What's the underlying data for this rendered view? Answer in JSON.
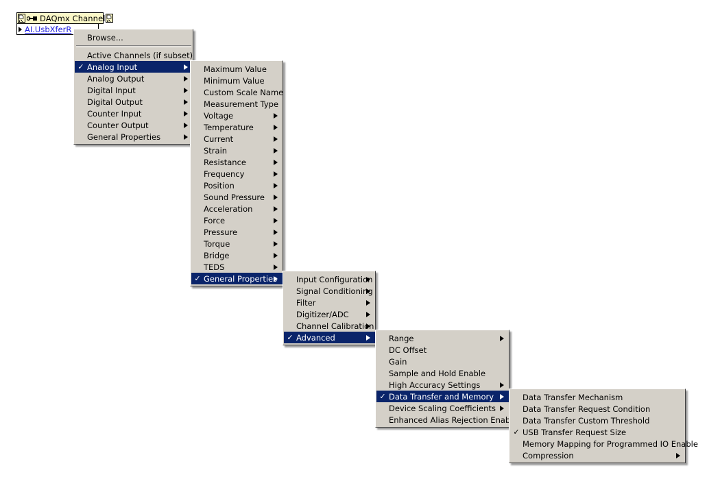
{
  "control": {
    "title": "DAQmx Channel",
    "value": "AI.UsbXferR",
    "icon_left": "document-glyph-icon",
    "icon_connector": "wire-connector-icon",
    "icon_right": "document-glyph-icon",
    "dropdown_arrow": "triangle-right-icon"
  },
  "colors": {
    "menu_background": "#d4d0c8",
    "menu_highlight": "#0a246a",
    "highlight_text": "#ffffff",
    "control_header": "#fbf8c8",
    "link_text": "#2222dd",
    "page_background": "#ffffff"
  },
  "menus": [
    {
      "name": "daqmx-channel-root-menu",
      "items": [
        {
          "label": "Browse...",
          "checked": false,
          "submenu": false
        },
        {
          "separator": true
        },
        {
          "label": "Active Channels (if subset)",
          "checked": false,
          "submenu": false
        },
        {
          "label": "Analog Input",
          "checked": true,
          "submenu": true,
          "selected": true
        },
        {
          "label": "Analog Output",
          "checked": false,
          "submenu": true
        },
        {
          "label": "Digital Input",
          "checked": false,
          "submenu": true
        },
        {
          "label": "Digital Output",
          "checked": false,
          "submenu": true
        },
        {
          "label": "Counter Input",
          "checked": false,
          "submenu": true
        },
        {
          "label": "Counter Output",
          "checked": false,
          "submenu": true
        },
        {
          "label": "General Properties",
          "checked": false,
          "submenu": true
        }
      ]
    },
    {
      "name": "analog-input-submenu",
      "items": [
        {
          "label": "Maximum Value",
          "checked": false,
          "submenu": false
        },
        {
          "label": "Minimum Value",
          "checked": false,
          "submenu": false
        },
        {
          "label": "Custom Scale Name",
          "checked": false,
          "submenu": false
        },
        {
          "label": "Measurement Type",
          "checked": false,
          "submenu": false
        },
        {
          "label": "Voltage",
          "checked": false,
          "submenu": true
        },
        {
          "label": "Temperature",
          "checked": false,
          "submenu": true
        },
        {
          "label": "Current",
          "checked": false,
          "submenu": true
        },
        {
          "label": "Strain",
          "checked": false,
          "submenu": true
        },
        {
          "label": "Resistance",
          "checked": false,
          "submenu": true
        },
        {
          "label": "Frequency",
          "checked": false,
          "submenu": true
        },
        {
          "label": "Position",
          "checked": false,
          "submenu": true
        },
        {
          "label": "Sound Pressure",
          "checked": false,
          "submenu": true
        },
        {
          "label": "Acceleration",
          "checked": false,
          "submenu": true
        },
        {
          "label": "Force",
          "checked": false,
          "submenu": true
        },
        {
          "label": "Pressure",
          "checked": false,
          "submenu": true
        },
        {
          "label": "Torque",
          "checked": false,
          "submenu": true
        },
        {
          "label": "Bridge",
          "checked": false,
          "submenu": true
        },
        {
          "label": "TEDS",
          "checked": false,
          "submenu": true
        },
        {
          "label": "General Properties",
          "checked": true,
          "submenu": true,
          "selected": true
        }
      ]
    },
    {
      "name": "general-properties-submenu",
      "items": [
        {
          "label": "Input Configuration",
          "checked": false,
          "submenu": true
        },
        {
          "label": "Signal Conditioning",
          "checked": false,
          "submenu": true
        },
        {
          "label": "Filter",
          "checked": false,
          "submenu": true
        },
        {
          "label": "Digitizer/ADC",
          "checked": false,
          "submenu": true
        },
        {
          "label": "Channel Calibration",
          "checked": false,
          "submenu": true
        },
        {
          "label": "Advanced",
          "checked": true,
          "submenu": true,
          "selected": true
        }
      ]
    },
    {
      "name": "advanced-submenu",
      "items": [
        {
          "label": "Range",
          "checked": false,
          "submenu": true
        },
        {
          "label": "DC Offset",
          "checked": false,
          "submenu": false
        },
        {
          "label": "Gain",
          "checked": false,
          "submenu": false
        },
        {
          "label": "Sample and Hold Enable",
          "checked": false,
          "submenu": false
        },
        {
          "label": "High Accuracy Settings",
          "checked": false,
          "submenu": true
        },
        {
          "label": "Data Transfer and Memory",
          "checked": true,
          "submenu": true,
          "selected": true
        },
        {
          "label": "Device Scaling Coefficients",
          "checked": false,
          "submenu": true
        },
        {
          "label": "Enhanced Alias Rejection Enable",
          "checked": false,
          "submenu": false
        }
      ]
    },
    {
      "name": "data-transfer-and-memory-submenu",
      "items": [
        {
          "label": "Data Transfer Mechanism",
          "checked": false,
          "submenu": false
        },
        {
          "label": "Data Transfer Request Condition",
          "checked": false,
          "submenu": false
        },
        {
          "label": "Data Transfer Custom Threshold",
          "checked": false,
          "submenu": false
        },
        {
          "label": "USB Transfer Request Size",
          "checked": true,
          "submenu": false
        },
        {
          "label": "Memory Mapping for Programmed IO Enable",
          "checked": false,
          "submenu": false
        },
        {
          "label": "Compression",
          "checked": false,
          "submenu": true
        }
      ]
    }
  ]
}
